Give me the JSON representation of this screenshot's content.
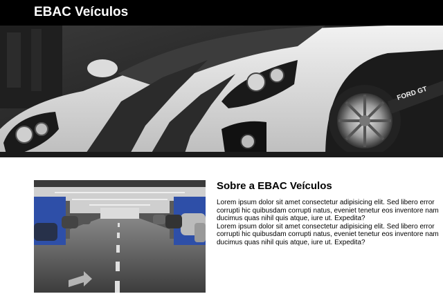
{
  "header": {
    "brand": "EBAC Veículos"
  },
  "hero": {
    "image_subject": "ford-gt-car-photo",
    "badge_text": "FORD GT"
  },
  "gallery": {
    "image_subject": "parking-garage-photo"
  },
  "about": {
    "title": "Sobre a EBAC Veículos",
    "paragraphs": [
      "Lorem ipsum dolor sit amet consectetur adipisicing elit. Sed libero error corrupti hic quibusdam corrupti natus, eveniet tenetur eos inventore nam ducimus quas nihil quis atque, iure ut. Expedita?",
      "Lorem ipsum dolor sit amet consectetur adipisicing elit. Sed libero error corrupti hic quibusdam corrupti natus, eveniet tenetur eos inventore nam ducimus quas nihil quis atque, iure ut. Expedita?"
    ]
  },
  "colors": {
    "header_bg": "#000000",
    "header_text": "#ffffff",
    "page_bg": "#ffffff"
  }
}
